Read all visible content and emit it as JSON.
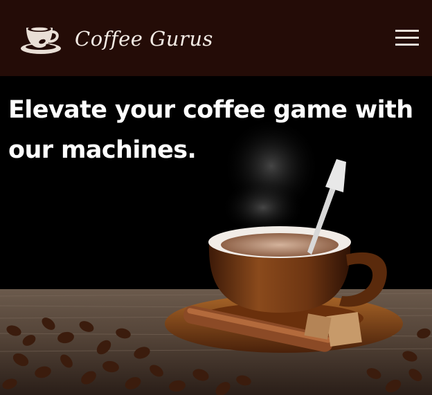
{
  "header": {
    "brand_name": "Coffee Gurus",
    "logo_icon": "coffee-cup-icon",
    "menu_icon": "hamburger-menu-icon"
  },
  "hero": {
    "headline": "Elevate your coffee game with our machines.",
    "image": "coffee-cup-with-beans-photo"
  },
  "colors": {
    "navbar_background": "#240c07",
    "brand_text": "#f3ebe4",
    "hero_background": "#000000",
    "headline_text": "#ffffff"
  }
}
